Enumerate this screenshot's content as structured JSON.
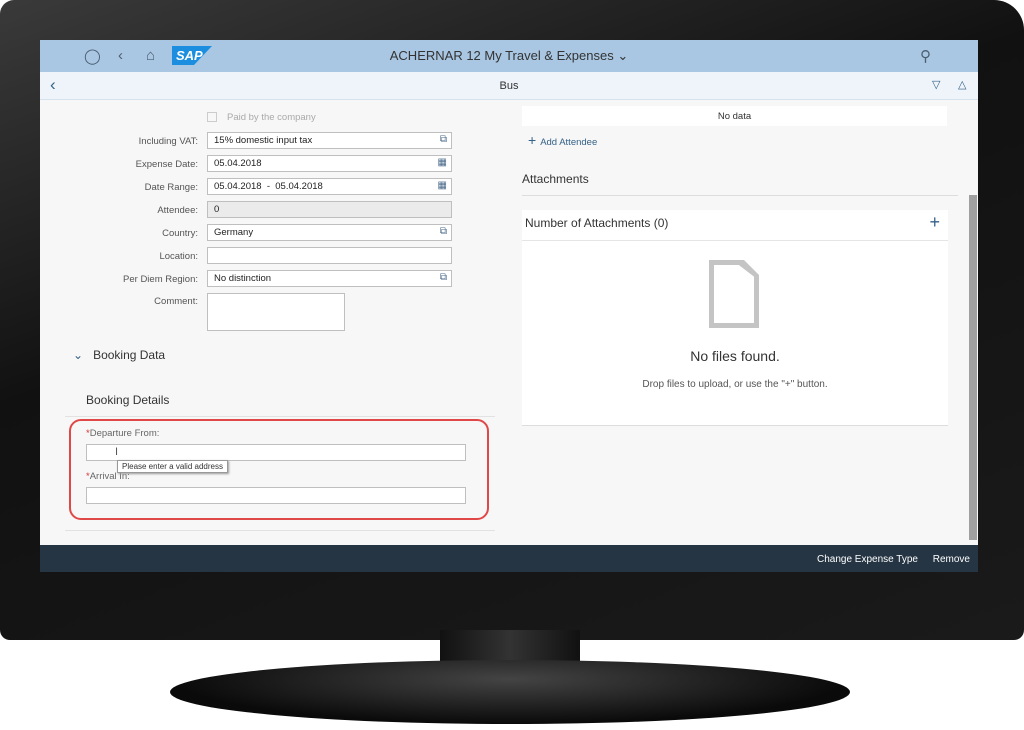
{
  "shell": {
    "title": "ACHERNAR 12 My Travel & Expenses",
    "logo": "SAP",
    "icons": [
      "user-icon",
      "back-icon",
      "home-icon",
      "search-icon"
    ]
  },
  "page": {
    "title": "Bus"
  },
  "form": {
    "paid_by_company": "Paid by the company",
    "fields": [
      {
        "label": "Including VAT:",
        "value": "15% domestic input tax",
        "icon": "value-help-icon"
      },
      {
        "label": "Expense Date:",
        "value": "05.04.2018",
        "icon": "calendar-icon"
      },
      {
        "label": "Date Range:",
        "value": "05.04.2018  -  05.04.2018",
        "icon": "calendar-icon"
      },
      {
        "label": "Attendee:",
        "value": "0"
      },
      {
        "label": "Country:",
        "value": "Germany",
        "icon": "value-help-icon"
      },
      {
        "label": "Location:",
        "value": ""
      },
      {
        "label": "Per Diem Region:",
        "value": "No distinction",
        "icon": "value-help-icon"
      },
      {
        "label": "Comment:",
        "value": ""
      }
    ],
    "booking_data": "Booking Data",
    "booking_details": "Booking Details",
    "departure_label": "Departure From:",
    "arrival_label": "Arrival In:",
    "required_mark": "*",
    "tooltip": "Please enter a valid address"
  },
  "attendees": {
    "no_data": "No data",
    "add": "Add Attendee"
  },
  "attachments": {
    "title": "Attachments",
    "count_label": "Number of Attachments (0)",
    "empty_title": "No files found.",
    "empty_text": "Drop files to upload, or use the \"+\" button."
  },
  "footer": {
    "change": "Change Expense Type",
    "remove": "Remove"
  },
  "colors": {
    "shell": "#a9c7e3",
    "footer": "#253543",
    "highlight": "#e04848"
  }
}
